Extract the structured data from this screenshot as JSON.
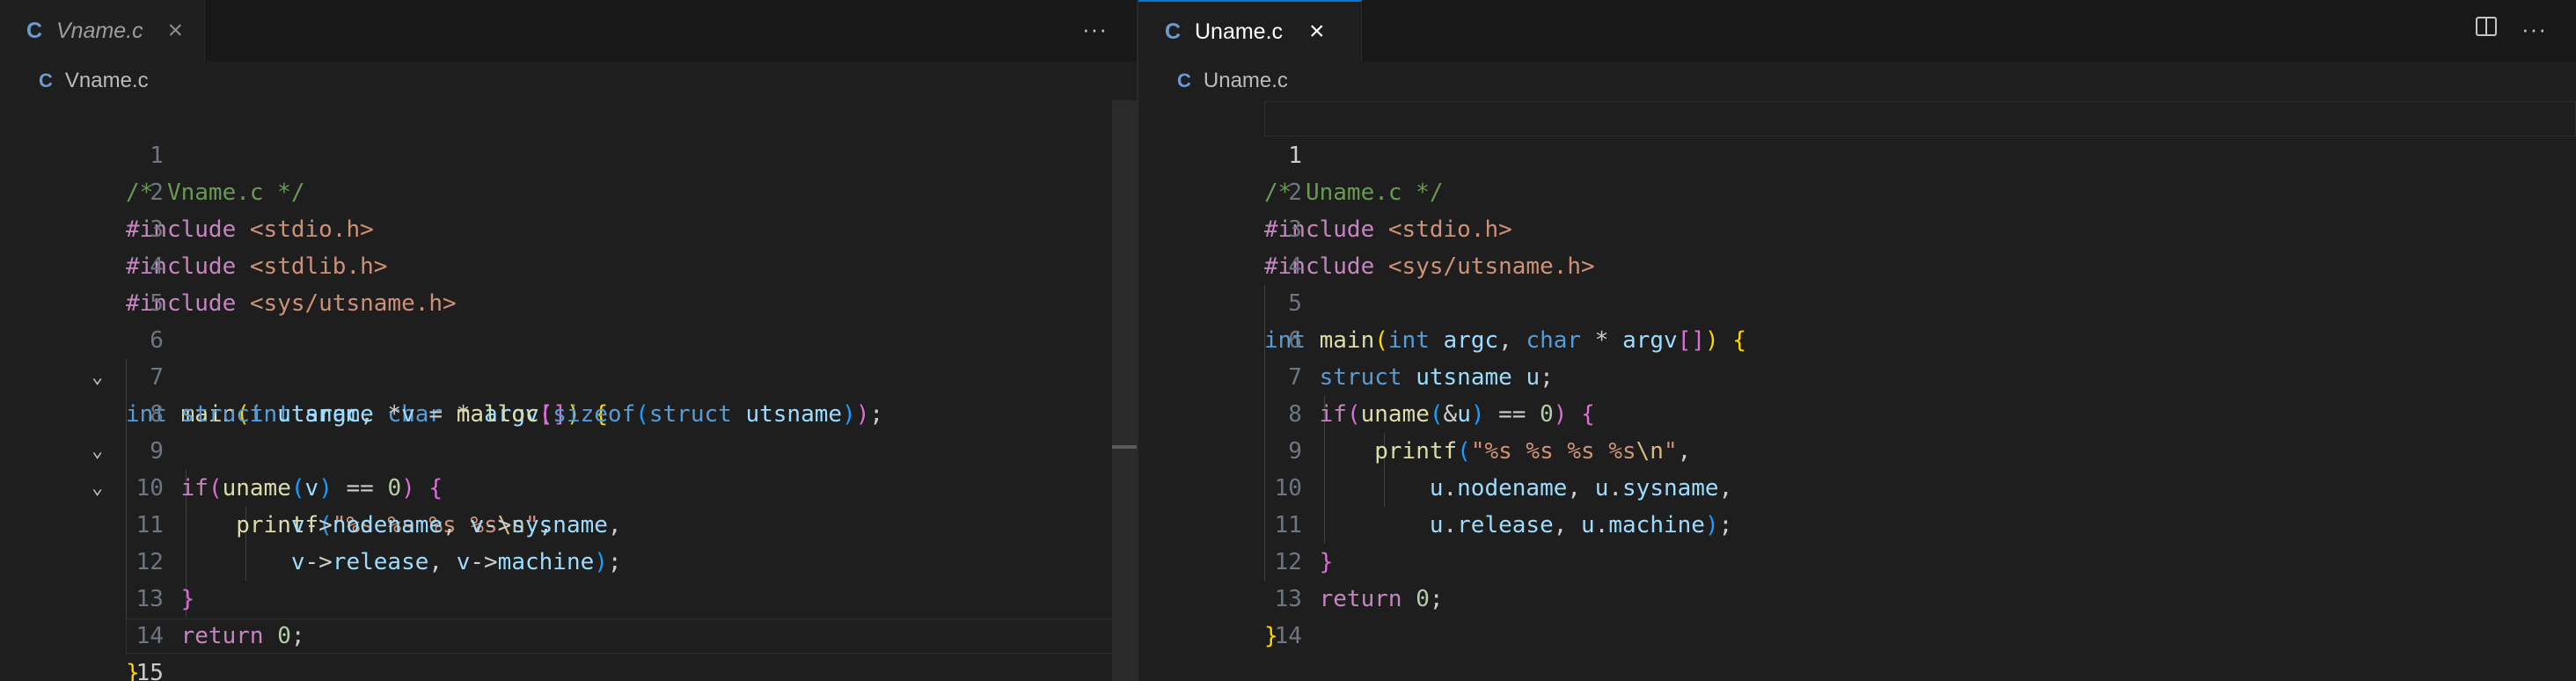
{
  "left_editor": {
    "tab": {
      "icon": "C",
      "filename": "Vname.c",
      "close": "×"
    },
    "more_actions": "···",
    "breadcrumb": {
      "icon": "C",
      "filename": "Vname.c"
    },
    "line_numbers": [
      "1",
      "2",
      "3",
      "4",
      "5",
      "6",
      "7",
      "8",
      "9",
      "10",
      "11",
      "12",
      "13",
      "14",
      "15"
    ],
    "active_line": "15"
  },
  "right_editor": {
    "tab": {
      "icon": "C",
      "filename": "Uname.c",
      "close": "×"
    },
    "split_editor_icon": "split-editor-icon",
    "more_actions": "···",
    "breadcrumb": {
      "icon": "C",
      "filename": "Uname.c"
    },
    "line_numbers": [
      "1",
      "2",
      "3",
      "4",
      "5",
      "6",
      "7",
      "8",
      "9",
      "10",
      "11",
      "12",
      "13",
      "14"
    ],
    "active_line": "1"
  },
  "colors": {
    "comment": "#6a9955",
    "preprocessor": "#c586c0",
    "string": "#ce9178",
    "keyword": "#569cd6",
    "function": "#dcdcaa",
    "variable": "#9cdcfe",
    "accent": "#0078d4"
  },
  "code_left": {
    "l1_comment": "/* Vname.c */",
    "l2_inc": "#include",
    "l2_hdr": "<stdio.h>",
    "l3_inc": "#include",
    "l3_hdr": "<stdlib.h>",
    "l4_inc": "#include",
    "l4_hdr": "<sys/utsname.h>",
    "l6_int": "int",
    "l6_main": "main",
    "l6_p1": "(",
    "l6_int2": "int",
    "l6_argc": "argc",
    "l6_comma": ", ",
    "l6_char": "char",
    "l6_star": " * ",
    "l6_argv": "argv",
    "l6_br1": "[",
    "l6_br2": "]",
    "l6_p2": ")",
    "l6_brace": "{",
    "l7_struct": "struct",
    "l7_utsname": "utsname",
    "l7_ptr": " *",
    "l7_v": "v",
    "l7_eq": " = ",
    "l7_malloc": "malloc",
    "l7_p1": "(",
    "l7_sizeof": "sizeof",
    "l7_p2": "(",
    "l7_struct2": "struct",
    "l7_utsname2": "utsname",
    "l7_p3": ")",
    "l7_p4": ")",
    "l7_semi": ";",
    "l8_if": "if",
    "l8_p1": "(",
    "l8_uname": "uname",
    "l8_p2": "(",
    "l8_v": "v",
    "l8_p3": ")",
    "l8_eq": " == ",
    "l8_zero": "0",
    "l8_p4": ")",
    "l8_brace": "{",
    "l9_printf": "printf",
    "l9_p1": "(",
    "l9_str1": "\"%s %s %s %s",
    "l9_esc": "\\n",
    "l9_str2": "\"",
    "l9_comma": ",",
    "l10_v1": "v",
    "l10_arrow1": "->",
    "l10_f1": "nodename",
    "l10_comma": ", ",
    "l10_v2": "v",
    "l10_arrow2": "->",
    "l10_f2": "sysname",
    "l10_comma2": ",",
    "l11_v1": "v",
    "l11_arrow1": "->",
    "l11_f1": "release",
    "l11_comma": ", ",
    "l11_v2": "v",
    "l11_arrow2": "->",
    "l11_f2": "machine",
    "l11_p": ")",
    "l11_semi": ";",
    "l12_brace": "}",
    "l13_return": "return",
    "l13_zero": "0",
    "l13_semi": ";",
    "l14_brace": "}"
  },
  "code_right": {
    "l1_comment": "/* Uname.c */",
    "l2_inc": "#include",
    "l2_hdr": "<stdio.h>",
    "l3_inc": "#include",
    "l3_hdr": "<sys/utsname.h>",
    "l5_int": "int",
    "l5_main": "main",
    "l5_p1": "(",
    "l5_int2": "int",
    "l5_argc": "argc",
    "l5_comma": ", ",
    "l5_char": "char",
    "l5_star": " * ",
    "l5_argv": "argv",
    "l5_br1": "[",
    "l5_br2": "]",
    "l5_p2": ")",
    "l5_brace": "{",
    "l6_struct": "struct",
    "l6_utsname": "utsname",
    "l6_u": "u",
    "l6_semi": ";",
    "l7_if": "if",
    "l7_p1": "(",
    "l7_uname": "uname",
    "l7_p2": "(",
    "l7_amp": "&",
    "l7_u": "u",
    "l7_p3": ")",
    "l7_eq": " == ",
    "l7_zero": "0",
    "l7_p4": ")",
    "l7_brace": "{",
    "l8_printf": "printf",
    "l8_p1": "(",
    "l8_str1": "\"%s %s %s %s",
    "l8_esc": "\\n",
    "l8_str2": "\"",
    "l8_comma": ",",
    "l9_u1": "u",
    "l9_dot1": ".",
    "l9_f1": "nodename",
    "l9_comma": ", ",
    "l9_u2": "u",
    "l9_dot2": ".",
    "l9_f2": "sysname",
    "l9_comma2": ",",
    "l10_u1": "u",
    "l10_dot1": ".",
    "l10_f1": "release",
    "l10_comma": ", ",
    "l10_u2": "u",
    "l10_dot2": ".",
    "l10_f2": "machine",
    "l10_p": ")",
    "l10_semi": ";",
    "l11_brace": "}",
    "l12_return": "return",
    "l12_zero": "0",
    "l12_semi": ";",
    "l13_brace": "}"
  }
}
